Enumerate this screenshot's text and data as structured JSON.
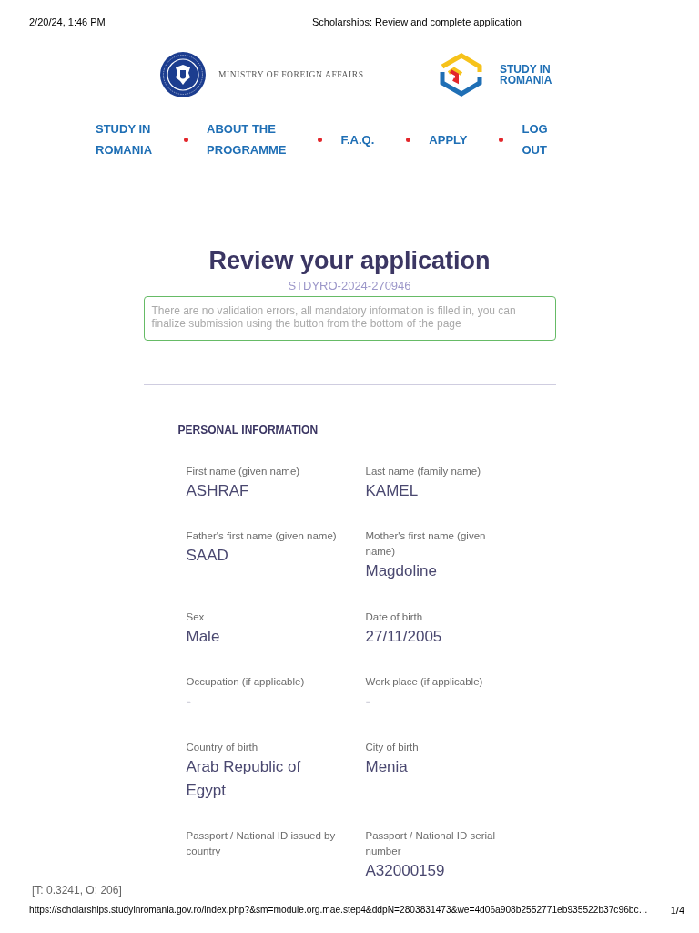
{
  "print_header": {
    "date": "2/20/24, 1:46 PM",
    "title": "Scholarships: Review and complete application"
  },
  "logos": {
    "ministry": "MINISTRY OF FOREIGN AFFAIRS",
    "study": "STUDY IN ROMANIA"
  },
  "nav": [
    {
      "label": "STUDY IN ROMANIA"
    },
    {
      "label": "ABOUT THE PROGRAMME"
    },
    {
      "label": "F.A.Q."
    },
    {
      "label": "APPLY"
    },
    {
      "label": "LOG OUT"
    }
  ],
  "page": {
    "title": "Review your application",
    "application_id": "STDYRO-2024-270946",
    "notice": {
      "kind": "success",
      "text": "There are no validation errors, all mandatory information is filled in, you can finalize submission using the button from the bottom of the page"
    }
  },
  "section": {
    "heading": "PERSONAL INFORMATION",
    "fields": [
      {
        "label": "First name (given name)",
        "value": "ASHRAF"
      },
      {
        "label": "Last name (family name)",
        "value": "KAMEL"
      },
      {
        "label": "Father's first name (given name)",
        "value": "SAAD"
      },
      {
        "label": "Mother's first name (given name)",
        "value": "Magdoline"
      },
      {
        "label": "Sex",
        "value": "Male"
      },
      {
        "label": "Date of birth",
        "value": "27/11/2005"
      },
      {
        "label": "Occupation (if applicable)",
        "value": "-"
      },
      {
        "label": "Work place (if applicable)",
        "value": "-"
      },
      {
        "label": "Country of birth",
        "value": "Arab Republic of Egypt"
      },
      {
        "label": "City of birth",
        "value": "Menia"
      },
      {
        "label": "Passport / National ID issued by country"
      },
      {
        "label": "Passport / National ID serial number",
        "value": "A32000159"
      }
    ]
  },
  "debug_text": "[T: 0.3241, O: 206]",
  "print_footer": {
    "url": "https://scholarships.studyinromania.gov.ro/index.php?&sm=module.org.mae.step4&ddpN=2803831473&we=4d06a908b2552771eb935522b37c96bc…",
    "page": "1/4"
  }
}
